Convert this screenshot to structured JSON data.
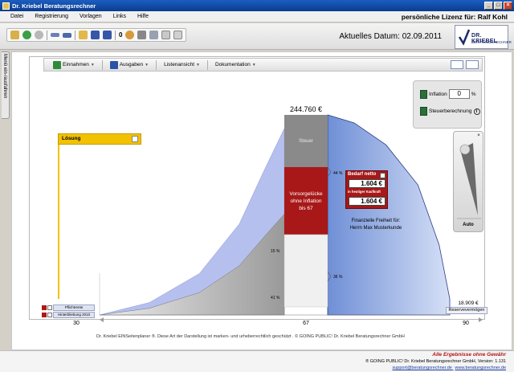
{
  "window": {
    "title": "Dr. Kriebel Beratungsrechner"
  },
  "menu": [
    "Datei",
    "Registrierung",
    "Vorlagen",
    "Links",
    "Hilfe"
  ],
  "license": "persönliche Lizenz für: Ralf Kohl",
  "toolbar": {
    "count": "0",
    "icons": [
      "home-icon",
      "forward-icon",
      "back-icon",
      "ruler-icon",
      "chart-line-icon",
      "open-folder-icon",
      "save-icon",
      "save-as-icon",
      "user-icon",
      "print-icon",
      "export-icon",
      "grid-icon",
      "window-icon"
    ]
  },
  "current_date": "Aktuelles Datum: 02.09.2011",
  "logo": {
    "name": "DR. KRIEBEL",
    "sub": "BERATUNGSRECHNER"
  },
  "sidetab": "Menü ein-/ausfahren",
  "tabs": [
    {
      "label": "Einnahmen",
      "color": "#2e8b3a"
    },
    {
      "label": "Ausgaben",
      "color": "#2a52a8"
    },
    {
      "label": "Listenansicht",
      "color": ""
    },
    {
      "label": "Dokumentation",
      "color": ""
    }
  ],
  "inflation": {
    "label": "Inflation",
    "value": "0",
    "unit": "%",
    "tax_label": "Steuerberechnung"
  },
  "auto_label": "Auto",
  "loesung_label": "Lösung",
  "chart_data": {
    "type": "area",
    "x_axis": {
      "start": "30",
      "mid": "67",
      "end": "90"
    },
    "total_label": "244.760 €",
    "reserve_value": "18.909 €",
    "reserve_label": "Reservevermögen",
    "segments": {
      "tax": "Steuer",
      "pension_gap": [
        "Vorsorgelücke",
        "ohne Inflation",
        "bis 67"
      ],
      "financial_freedom": [
        "Finanzielle Freiheit für:",
        "Herrn Max Musterkunde"
      ]
    },
    "percent_labels": {
      "upper_right": "44 %",
      "lower_right": "36 %",
      "upper_left": "15 %",
      "lower_left": "41 %"
    },
    "accumulation_curve": [
      [
        30,
        0
      ],
      [
        40,
        3
      ],
      [
        50,
        10
      ],
      [
        58,
        22
      ],
      [
        63,
        35
      ],
      [
        67,
        45
      ]
    ],
    "decumulation_curve": [
      [
        67,
        100
      ],
      [
        72,
        96
      ],
      [
        78,
        85
      ],
      [
        84,
        65
      ],
      [
        88,
        35
      ],
      [
        90,
        8
      ]
    ]
  },
  "bedarf": {
    "title": "Bedarf netto",
    "value1": "1.604 €",
    "subtitle": "in heutiger Kaufkraft",
    "value2": "1.604 €"
  },
  "legend": [
    "Pflichtrente",
    "Hinterbliebung 2010"
  ],
  "copyright": "Dr. Kriebel EINSeitenplaner ®. Diese Art der Darstellung ist marken- und urheberrechtlich geschützt . © GOING PUBLIC! Dr. Kriebel Beratungsrechner GmbH",
  "footer": {
    "slogan": "Alle Ergebnisse ohne Gewähr",
    "company": "® GOING PUBLIC! Dr. Kriebel Beratungsrechner GmbH, Version: 1.131",
    "support": "support@beratungsrechner.de",
    "web": "www.beratungsrechner.de"
  },
  "colors": {
    "accent_blue": "#7b9cdc",
    "gap_red": "#a81818",
    "tax_gray": "#8a8a8a",
    "loesung_yellow": "#f2c200"
  }
}
